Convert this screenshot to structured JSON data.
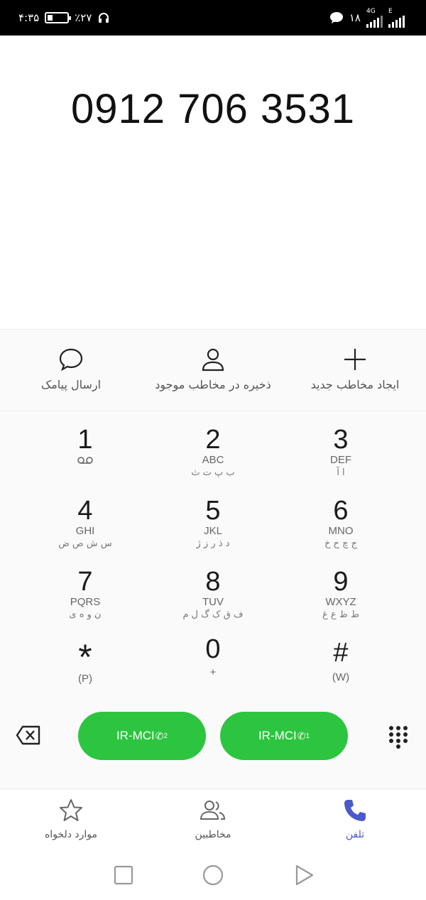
{
  "status_bar": {
    "time": "۴:۳۵",
    "battery_percent": "٪۲۷",
    "battery_level": 0.27,
    "notifications_count": "۱۸",
    "network_type_1": "4G",
    "network_type_2": "E",
    "icons": [
      "headphones-icon",
      "battery-icon",
      "message-icon",
      "signal-icon"
    ]
  },
  "dialer": {
    "number": "0912 706 3531"
  },
  "actions": [
    {
      "name": "send-sms",
      "label": "ارسال پیامک",
      "icon": "message-bubble-icon"
    },
    {
      "name": "save-to-existing",
      "label": "ذخیره در مخاطب موجود",
      "icon": "person-icon"
    },
    {
      "name": "create-contact",
      "label": "ایجاد مخاطب جدید",
      "icon": "plus-icon"
    }
  ],
  "keypad": {
    "keys": [
      {
        "digit": "1",
        "en": "",
        "fa": "",
        "sub_icon": "voicemail-icon"
      },
      {
        "digit": "2",
        "en": "ABC",
        "fa": "ب پ ت ث"
      },
      {
        "digit": "3",
        "en": "DEF",
        "fa": "ا آ"
      },
      {
        "digit": "4",
        "en": "GHI",
        "fa": "س ش ص ض"
      },
      {
        "digit": "5",
        "en": "JKL",
        "fa": "د ذ ر ز ژ"
      },
      {
        "digit": "6",
        "en": "MNO",
        "fa": "ج چ ح خ"
      },
      {
        "digit": "7",
        "en": "PQRS",
        "fa": "ن و ه ی"
      },
      {
        "digit": "8",
        "en": "TUV",
        "fa": "ف ق ک گ ل م"
      },
      {
        "digit": "9",
        "en": "WXYZ",
        "fa": "ط ظ ع غ"
      },
      {
        "digit": "*",
        "en": "(P)",
        "fa": ""
      },
      {
        "digit": "0",
        "en": "+",
        "fa": ""
      },
      {
        "digit": "#",
        "en": "(W)",
        "fa": ""
      }
    ]
  },
  "call_buttons": [
    {
      "label": "IR-MCI",
      "sim": "2"
    },
    {
      "label": "IR-MCI",
      "sim": "1"
    }
  ],
  "tabs": [
    {
      "name": "favorites",
      "label": "موارد دلخواه",
      "icon": "star-icon",
      "active": false
    },
    {
      "name": "contacts",
      "label": "مخاطبین",
      "icon": "people-icon",
      "active": false
    },
    {
      "name": "phone",
      "label": "تلفن",
      "icon": "phone-icon",
      "active": true
    }
  ],
  "colors": {
    "call_green": "#2dc53f",
    "active_tab": "#4b5ac8"
  }
}
